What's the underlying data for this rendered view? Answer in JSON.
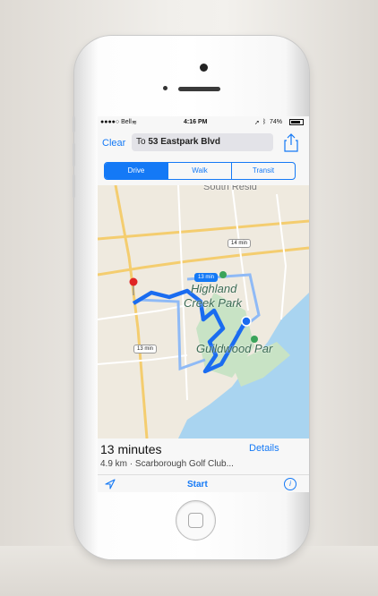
{
  "status_bar": {
    "carrier": "●●●●○ Bell ",
    "time": "4:16 PM",
    "battery": "74%"
  },
  "nav": {
    "clear_label": "Clear",
    "destination_prefix": "To ",
    "destination": "53 Eastpark Blvd"
  },
  "modes": {
    "drive": "Drive",
    "walk": "Walk",
    "transit": "Transit",
    "selected": "Drive"
  },
  "map": {
    "area_top": "South Resid",
    "area_name_line1": "Highland",
    "area_name_line2": "Creek Park",
    "park_name": "Guildwood Par",
    "route_times": [
      "14 min",
      "13 min",
      "13 min"
    ]
  },
  "route": {
    "duration": "13 minutes",
    "details_label": "Details",
    "summary": "4.9 km · Scarborough Golf Club..."
  },
  "toolbar": {
    "start_label": "Start",
    "info_glyph": "i",
    "location_icon": "location-arrow-icon"
  },
  "colors": {
    "accent": "#1479f6",
    "water": "#a9d4f0",
    "park": "#c8e3c5"
  }
}
